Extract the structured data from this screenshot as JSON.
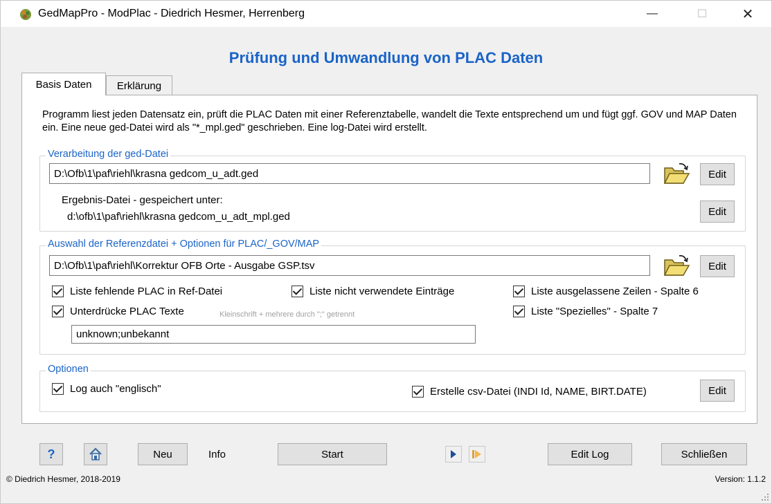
{
  "window": {
    "title": "GedMapPro - ModPlac  -  Diedrich Hesmer, Herrenberg",
    "minimize_glyph": "—",
    "maximize_glyph": "☐",
    "close_glyph": "✕"
  },
  "heading": "Prüfung und Umwandlung von PLAC Daten",
  "tabs": [
    {
      "label": "Basis Daten",
      "active": true
    },
    {
      "label": "Erklärung",
      "active": false
    }
  ],
  "intro": "Programm liest jeden Datensatz ein, prüft die PLAC Daten mit einer Referenztabelle, wandelt die Texte entsprechend um und fügt ggf. GOV und MAP Daten ein. Eine neue ged-Datei wird als \"*_mpl.ged\" geschrieben. Eine log-Datei wird erstellt.",
  "ged_group": {
    "label": "Verarbeitung der ged-Datei",
    "input_path": "D:\\Ofb\\1\\paf\\riehl\\krasna gedcom_u_adt.ged",
    "edit_label": "Edit",
    "result_label": "Ergebnis-Datei - gespeichert unter:",
    "result_path": "d:\\ofb\\1\\paf\\riehl\\krasna gedcom_u_adt_mpl.ged",
    "result_edit_label": "Edit"
  },
  "ref_group": {
    "label": "Auswahl der Referenzdatei + Optionen für PLAC/_GOV/MAP",
    "ref_path": "D:\\Ofb\\1\\paf\\riehl\\Korrektur OFB Orte - Ausgabe GSP.tsv",
    "edit_label": "Edit",
    "cb_missing": "Liste fehlende PLAC in Ref-Datei",
    "cb_unused": "Liste nicht verwendete Einträge",
    "cb_skipped": "Liste ausgelassene Zeilen - Spalte 6",
    "cb_suppress": "Unterdrücke PLAC Texte",
    "suppress_hint": "Kleinschrift + mehrere durch \";\" getrennt",
    "cb_special": "Liste \"Spezielles\" - Spalte 7",
    "suppress_value": "unknown;unbekannt"
  },
  "options_group": {
    "label": "Optionen",
    "cb_log_english": "Log auch \"englisch\"",
    "cb_csv": "Erstelle csv-Datei (INDI Id, NAME, BIRT.DATE)",
    "edit_label": "Edit"
  },
  "bottom": {
    "help_glyph": "?",
    "new_label": "Neu",
    "info_label": "Info",
    "start_label": "Start",
    "edit_log_label": "Edit Log",
    "close_label": "Schließen"
  },
  "footer": {
    "copyright": "© Diedrich Hesmer, 2018-2019",
    "version": "Version:  1.1.2"
  },
  "colors": {
    "accent": "#1a63c7",
    "hint": "#a0a0a0",
    "button": "#e1e1e1"
  },
  "icons": [
    "app-icon",
    "folder-open-icon",
    "help-icon",
    "home-icon",
    "arrow-right-icon",
    "play-next-icon",
    "resize-grip-icon"
  ]
}
